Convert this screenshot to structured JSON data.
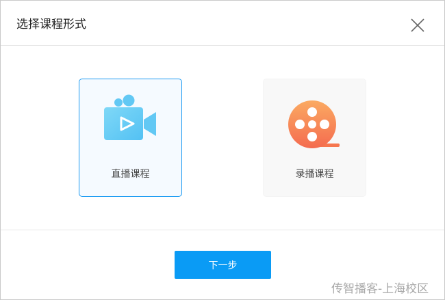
{
  "dialog": {
    "title": "选择课程形式",
    "close_icon": "close-icon"
  },
  "options": [
    {
      "label": "直播课程",
      "icon": "video-camera-icon",
      "selected": true,
      "accent": "#5bc8f5"
    },
    {
      "label": "录播课程",
      "icon": "film-reel-icon",
      "selected": false,
      "accent": "#f57a54"
    }
  ],
  "footer": {
    "next_label": "下一步"
  },
  "watermark": "传智播客-上海校区",
  "colors": {
    "primary": "#0a9bf5",
    "selected_border": "#1a9af2"
  }
}
